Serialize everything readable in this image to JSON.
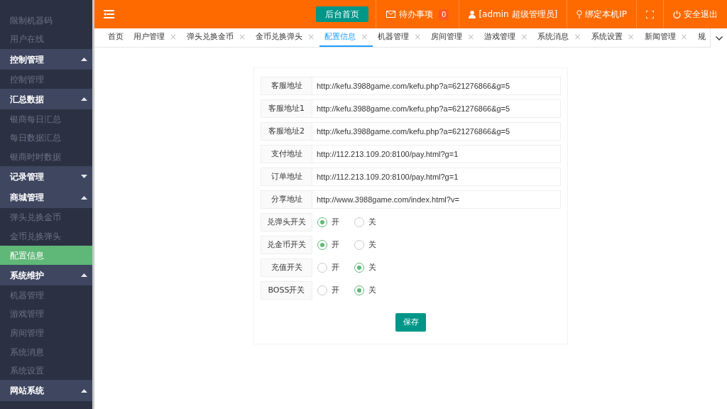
{
  "sidebar": {
    "entries": [
      {
        "kind": "link",
        "label": "限制机器码",
        "selected": false
      },
      {
        "kind": "link",
        "label": "用户在线",
        "selected": false
      },
      {
        "kind": "group",
        "label": "控制管理",
        "expanded": true,
        "children": [
          {
            "label": "控制管理",
            "selected": false
          }
        ]
      },
      {
        "kind": "group",
        "label": "汇总数据",
        "expanded": true,
        "children": [
          {
            "label": "银商每日汇总",
            "selected": false
          },
          {
            "label": "每日数据汇总",
            "selected": false
          },
          {
            "label": "银商时时数据",
            "selected": false
          }
        ]
      },
      {
        "kind": "group",
        "label": "记录管理",
        "expanded": false
      },
      {
        "kind": "group",
        "label": "商城管理",
        "expanded": true,
        "children": [
          {
            "label": "弹头兑换金币",
            "selected": false
          },
          {
            "label": "金币兑换弹头",
            "selected": false
          },
          {
            "label": "配置信息",
            "selected": true
          }
        ]
      },
      {
        "kind": "group",
        "label": "系统维护",
        "expanded": true,
        "children": [
          {
            "label": "机器管理",
            "selected": false
          },
          {
            "label": "游戏管理",
            "selected": false
          },
          {
            "label": "房间管理",
            "selected": false
          },
          {
            "label": "系统消息",
            "selected": false
          },
          {
            "label": "系统设置",
            "selected": false
          }
        ]
      },
      {
        "kind": "group",
        "label": "网站系统",
        "expanded": true
      }
    ]
  },
  "header": {
    "home_button": "后台首页",
    "todo": {
      "label": "待办事项",
      "count": "0"
    },
    "user": "[admin 超级管理员]",
    "bind_ip": "绑定本机IP",
    "logout": "安全退出"
  },
  "tabs": [
    {
      "label": "首页",
      "selected": false
    },
    {
      "label": "用户管理",
      "close": "×",
      "selected": false
    },
    {
      "label": "弹头兑换金币",
      "close": "×",
      "selected": false
    },
    {
      "label": "金币兑换弹头",
      "close": "×",
      "selected": false
    },
    {
      "label": "配置信息",
      "close": "×",
      "selected": true
    },
    {
      "label": "机器管理",
      "close": "×",
      "selected": false
    },
    {
      "label": "房间管理",
      "close": "×",
      "selected": false
    },
    {
      "label": "游戏管理",
      "close": "×",
      "selected": false
    },
    {
      "label": "系统消息",
      "close": "×",
      "selected": false
    },
    {
      "label": "系统设置",
      "close": "×",
      "selected": false
    },
    {
      "label": "新闻管理",
      "close": "×",
      "selected": false
    },
    {
      "label": "规",
      "selected": false
    }
  ],
  "form": {
    "fields": [
      {
        "label": "客服地址",
        "value": "http://kefu.3988game.com/kefu.php?a=621276866&g=5"
      },
      {
        "label": "客服地址1",
        "value": "http://kefu.3988game.com/kefu.php?a=621276866&g=5"
      },
      {
        "label": "客服地址2",
        "value": "http://kefu.3988game.com/kefu.php?a=621276866&g=5"
      },
      {
        "label": "支付地址",
        "value": "http://112.213.109.20:8100/pay.html?g=1"
      },
      {
        "label": "订单地址",
        "value": "http://112.213.109.20:8100/pay.html?g=1"
      },
      {
        "label": "分享地址",
        "value": "http://www.3988game.com/index.html?v="
      }
    ],
    "switches": [
      {
        "label": "兑弹头开关",
        "options": [
          {
            "label": "开",
            "selected": true
          },
          {
            "label": "关",
            "selected": false
          }
        ]
      },
      {
        "label": "兑金币开关",
        "options": [
          {
            "label": "开",
            "selected": true
          },
          {
            "label": "关",
            "selected": false
          }
        ]
      },
      {
        "label": "充值开关",
        "options": [
          {
            "label": "开",
            "selected": false
          },
          {
            "label": "关",
            "selected": true
          }
        ]
      },
      {
        "label": "BOSS开关",
        "options": [
          {
            "label": "开",
            "selected": false
          },
          {
            "label": "关",
            "selected": true
          }
        ]
      }
    ],
    "save_button": "保存"
  }
}
